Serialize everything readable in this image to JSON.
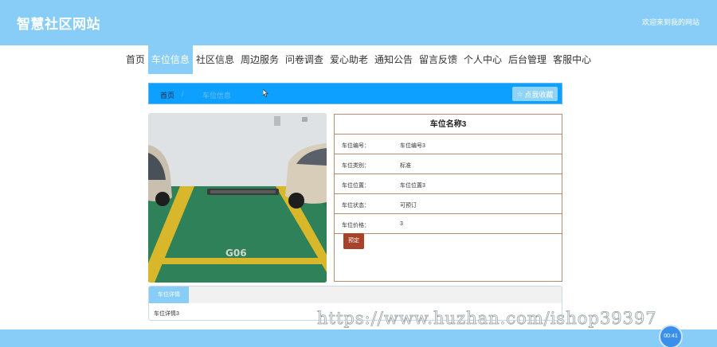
{
  "header": {
    "site_title": "智慧社区网站",
    "welcome": "欢迎来到我的网站"
  },
  "nav": {
    "items": [
      {
        "label": "首页"
      },
      {
        "label": "车位信息",
        "active": true
      },
      {
        "label": "社区信息"
      },
      {
        "label": "周边服务"
      },
      {
        "label": "问卷调查"
      },
      {
        "label": "爱心助老"
      },
      {
        "label": "通知公告"
      },
      {
        "label": "留言反馈"
      },
      {
        "label": "个人中心"
      },
      {
        "label": "后台管理"
      },
      {
        "label": "客服中心"
      }
    ]
  },
  "breadcrumb": {
    "home": "首页",
    "separator": "/",
    "current": "车位信息",
    "favorite_label": "点我收藏"
  },
  "detail": {
    "title": "车位名称3",
    "rows": [
      {
        "key": "车位编号：",
        "value": "车位编号3"
      },
      {
        "key": "车位类别：",
        "value": "标准"
      },
      {
        "key": "车位位置：",
        "value": "车位位置3"
      },
      {
        "key": "车位状态：",
        "value": "可预订"
      },
      {
        "key": "车位价格：",
        "value": "3"
      }
    ],
    "book_label": "预定"
  },
  "photo": {
    "slot_label": "G06"
  },
  "tabs": {
    "tab_label": "车位详情",
    "content": "车位详情3"
  },
  "watermark": "https://www.huzhan.com/ishop39397",
  "timer": "00:41",
  "colors": {
    "header_bg": "#87cdf7",
    "breadcrumb_bg": "#0ea0ff",
    "book_button": "#a6432a",
    "info_border": "#b88b74"
  }
}
